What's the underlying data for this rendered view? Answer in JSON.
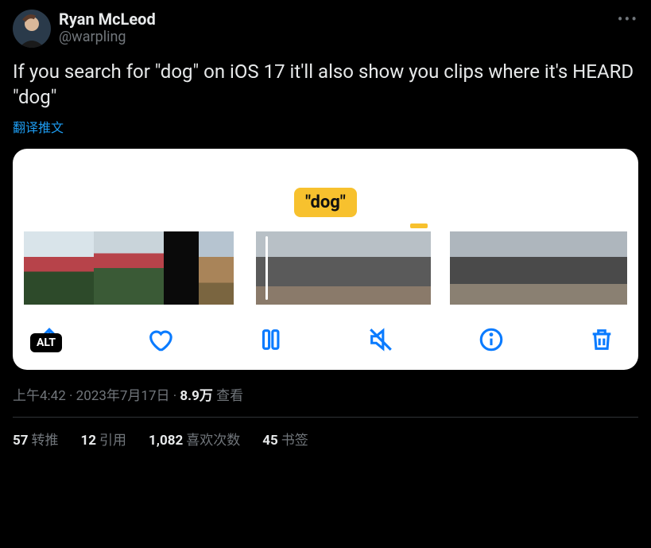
{
  "user": {
    "display_name": "Ryan McLeod",
    "handle": "@warpling"
  },
  "tweet": {
    "text": "If you search for \"dog\" on iOS 17 it'll also show you clips where it's HEARD \"dog\"",
    "translate_label": "翻译推文"
  },
  "media": {
    "caption_chip": "\"dog\"",
    "alt_badge": "ALT",
    "toolbar": {
      "share": "share-icon",
      "like": "heart-icon",
      "pause": "pause-icon",
      "mute": "mute-icon",
      "info": "info-icon",
      "trash": "trash-icon"
    }
  },
  "meta": {
    "time": "上午4:42",
    "date": "2023年7月17日",
    "views_count": "8.9万",
    "views_label": "查看"
  },
  "stats": {
    "retweets": {
      "count": "57",
      "label": "转推"
    },
    "quotes": {
      "count": "12",
      "label": "引用"
    },
    "likes": {
      "count": "1,082",
      "label": "喜欢次数"
    },
    "bookmarks": {
      "count": "45",
      "label": "书签"
    }
  }
}
